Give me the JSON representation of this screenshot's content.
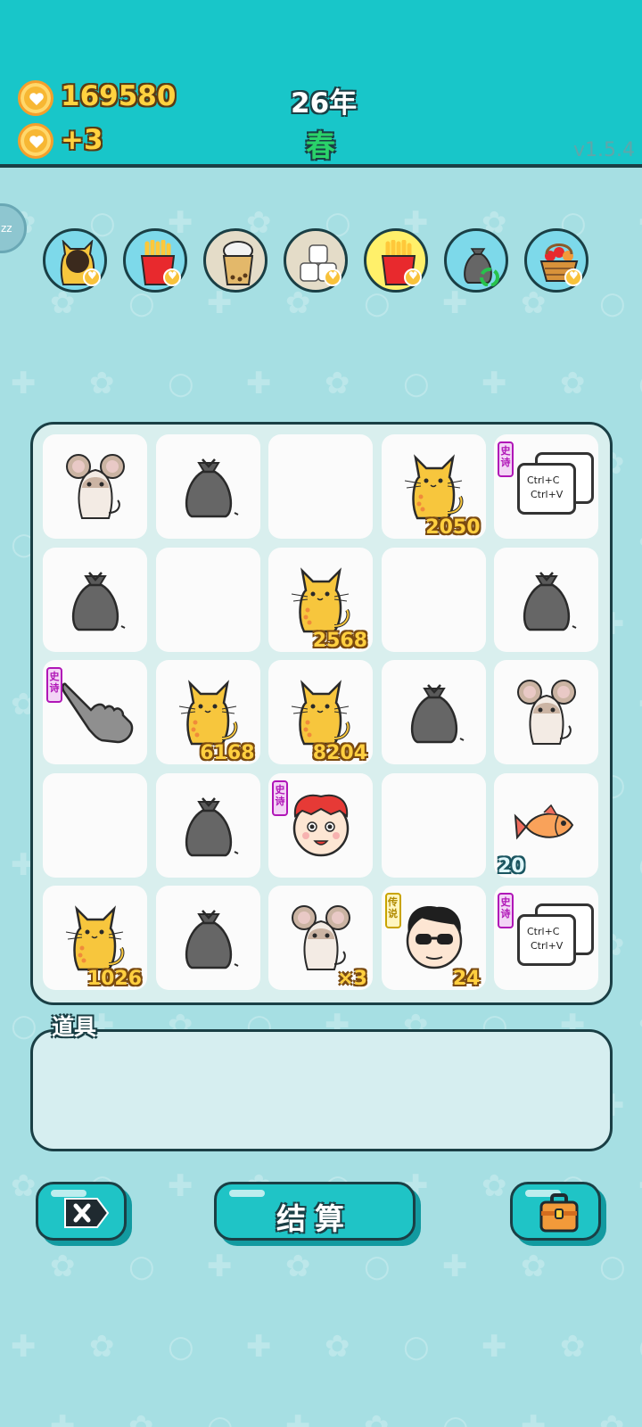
{
  "header": {
    "coins": "169580",
    "income": "+3",
    "year": "26年",
    "season": "春",
    "version": "v1.5.4"
  },
  "side_tab": {
    "label": "zz"
  },
  "item_row": [
    {
      "icon": "hole-cat-icon",
      "bg": "#7dd9ea",
      "badge": "coin-heart"
    },
    {
      "icon": "fries-icon",
      "bg": "#7dd9ea",
      "badge": "coin-heart"
    },
    {
      "icon": "bubble-tea-icon",
      "bg": "#e4dcc8",
      "badge": ""
    },
    {
      "icon": "sugar-cubes-icon",
      "bg": "#e4dcc8",
      "badge": "coin-heart"
    },
    {
      "icon": "fries-icon",
      "bg": "#fff06a",
      "badge": "coin-heart"
    },
    {
      "icon": "recycle-bag-icon",
      "bg": "#7dd9ea",
      "badge": "recycle"
    },
    {
      "icon": "fruit-basket-icon",
      "bg": "#7dd9ea",
      "badge": "coin-heart"
    }
  ],
  "board": {
    "rows": [
      [
        {
          "icon": "mouse-icon",
          "value": "",
          "tag": ""
        },
        {
          "icon": "trash-bag-icon",
          "value": "",
          "tag": ""
        },
        {
          "icon": "",
          "value": "",
          "tag": ""
        },
        {
          "icon": "cat-icon",
          "value": "2050",
          "tag": ""
        },
        {
          "icon": "copy-paste-icon",
          "value": "",
          "tag": "史诗"
        }
      ],
      [
        {
          "icon": "trash-bag-icon",
          "value": "",
          "tag": ""
        },
        {
          "icon": "",
          "value": "",
          "tag": ""
        },
        {
          "icon": "cat-icon",
          "value": "2568",
          "tag": ""
        },
        {
          "icon": "",
          "value": "",
          "tag": ""
        },
        {
          "icon": "trash-bag-icon",
          "value": "",
          "tag": ""
        }
      ],
      [
        {
          "icon": "pointing-hand-icon",
          "value": "",
          "tag": "史诗"
        },
        {
          "icon": "cat-icon",
          "value": "6168",
          "tag": ""
        },
        {
          "icon": "cat-icon",
          "value": "8204",
          "tag": ""
        },
        {
          "icon": "trash-bag-icon",
          "value": "",
          "tag": ""
        },
        {
          "icon": "mouse-icon",
          "value": "",
          "tag": ""
        }
      ],
      [
        {
          "icon": "",
          "value": "",
          "tag": ""
        },
        {
          "icon": "trash-bag-icon",
          "value": "",
          "tag": ""
        },
        {
          "icon": "red-hat-face-icon",
          "value": "",
          "tag": "史诗"
        },
        {
          "icon": "",
          "value": "",
          "tag": ""
        },
        {
          "icon": "fish-icon",
          "value": "20",
          "tag": ""
        }
      ],
      [
        {
          "icon": "cat-icon",
          "value": "1026",
          "tag": ""
        },
        {
          "icon": "trash-bag-icon",
          "value": "",
          "tag": ""
        },
        {
          "icon": "mouse-icon",
          "value": "×3",
          "tag": ""
        },
        {
          "icon": "sunglasses-man-icon",
          "value": "24",
          "tag": "传说"
        },
        {
          "icon": "copy-paste-icon",
          "value": "",
          "tag": "史诗"
        }
      ]
    ],
    "copy_text": [
      "Ctrl+C",
      "Ctrl+V"
    ]
  },
  "tools": {
    "label": "道具"
  },
  "buttons": {
    "close_icon": "close-tag-icon",
    "settle_label": "结算",
    "bag_icon": "briefcase-icon"
  }
}
